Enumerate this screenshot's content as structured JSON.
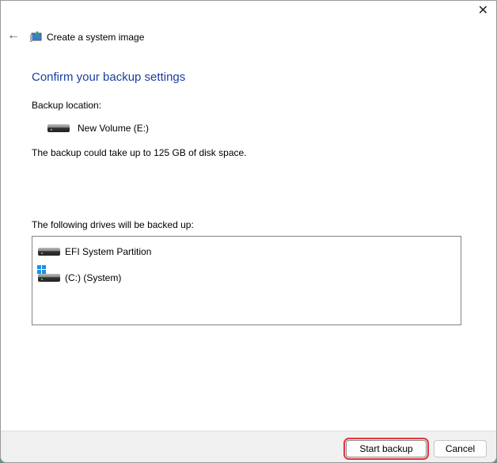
{
  "window": {
    "title": "Create a system image",
    "close": "✕",
    "back": "←"
  },
  "heading": "Confirm your backup settings",
  "backup_location_label": "Backup location:",
  "backup_location": "New Volume (E:)",
  "space_note": "The backup could take up to 125 GB of disk space.",
  "drives_label": "The following drives will be backed up:",
  "drives": [
    "EFI System Partition",
    "(C:) (System)"
  ],
  "buttons": {
    "start": "Start backup",
    "cancel": "Cancel"
  }
}
